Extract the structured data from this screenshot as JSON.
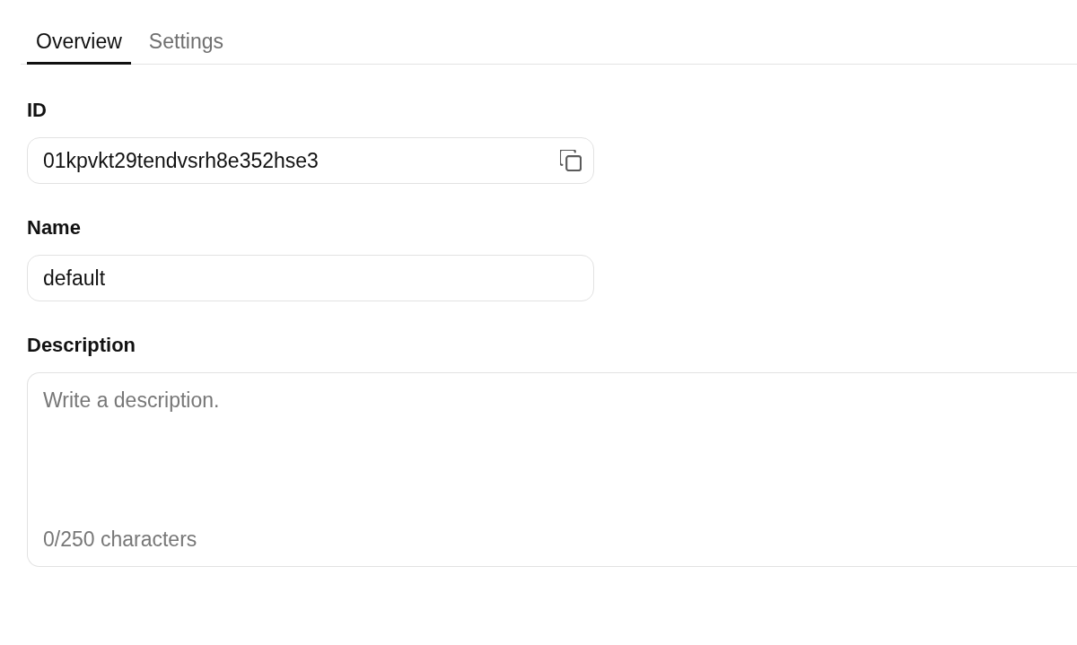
{
  "tabs": [
    {
      "label": "Overview",
      "selected": true
    },
    {
      "label": "Settings",
      "selected": false
    }
  ],
  "fields": [
    {
      "kind": "copyable",
      "label": "ID",
      "value": "01kpvkt29tendvsrh8e352hse3"
    },
    {
      "kind": "text",
      "label": "Name",
      "value": "default"
    },
    {
      "kind": "textarea",
      "label": "Description",
      "placeholder": "Write a description.",
      "counter": "0/250 characters"
    }
  ]
}
